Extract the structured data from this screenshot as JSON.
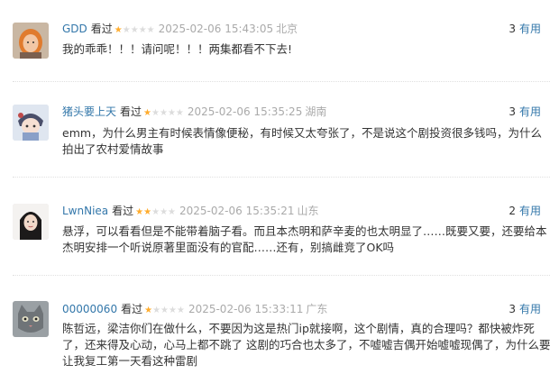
{
  "comments": [
    {
      "user": "GDD",
      "status": "看过",
      "rating": 1,
      "time": "2025-02-06 15:43:05",
      "location": "北京",
      "votes": "3",
      "useful_label": "有用",
      "text": "我的乖乖！！！请问呢！！！两集都看不下去!",
      "avatar": "avatar-woman-orange"
    },
    {
      "user": "猪头要上天",
      "status": "看过",
      "rating": 1,
      "time": "2025-02-06 15:35:25",
      "location": "湖南",
      "votes": "3",
      "useful_label": "有用",
      "text": "emm，为什么男主有时候表情像便秘，有时候又太夸张了，不是说这个剧投资很多钱吗，为什么拍出了农村爱情故事",
      "avatar": "avatar-cartoon-character"
    },
    {
      "user": "LwnNiea",
      "status": "看过",
      "rating": 2,
      "time": "2025-02-06 15:35:21",
      "location": "山东",
      "votes": "2",
      "useful_label": "有用",
      "text": "悬浮，可以看看但是不能带着脑子看。而且本杰明和萨辛麦的也太明显了……既要又要，还要给本杰明安排一个听说原著里面没有的官配……还有，别搞雌竞了OK吗",
      "avatar": "avatar-woman-dark-hair"
    },
    {
      "user": "00000060",
      "status": "看过",
      "rating": 1,
      "time": "2025-02-06 15:33:11",
      "location": "广东",
      "votes": "3",
      "useful_label": "有用",
      "text": "陈哲远，梁洁你们在做什么，不要因为这是热门ip就接啊，这个剧情，真的合理吗？都快被炸死了，还来得及心动，心马上都不跳了 这剧的巧合也太多了，不嘘嘘吉偶开始嘘嘘现偶了，为什么要让我复工第一天看这种雷剧",
      "avatar": "avatar-cat-photo"
    }
  ]
}
